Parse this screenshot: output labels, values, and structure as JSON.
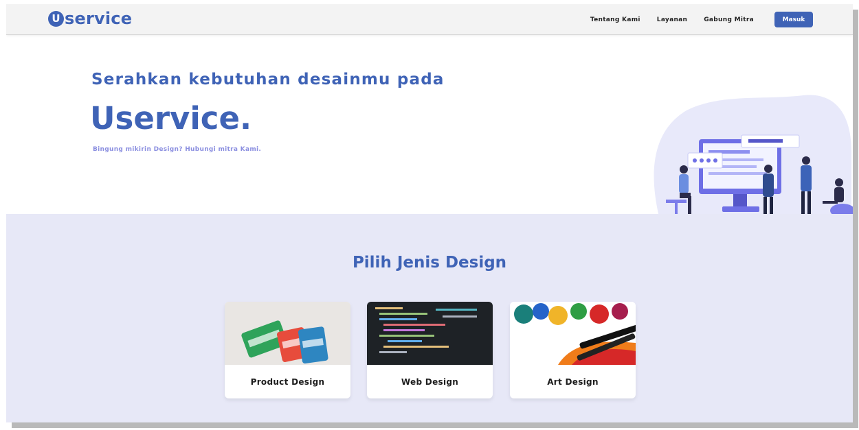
{
  "brand": {
    "logo_letter": "U",
    "logo_text": "service"
  },
  "nav": {
    "links": [
      "Tentang Kami",
      "Layanan",
      "Gabung Mitra"
    ],
    "login_label": "Masuk"
  },
  "hero": {
    "subtitle": "Serahkan kebutuhan desainmu pada",
    "title": "Uservice.",
    "tagline": "Bingung mikirin Design? Hubungi mitra Kami."
  },
  "categories": {
    "heading": "Pilih Jenis Design",
    "items": [
      {
        "label": "Product Design",
        "image": "product-packages-photo"
      },
      {
        "label": "Web Design",
        "image": "code-editor-photo"
      },
      {
        "label": "Art Design",
        "image": "paint-brush-photo"
      }
    ]
  },
  "colors": {
    "brand": "#3f63b6",
    "tagline": "#8b8fe0",
    "section_bg": "#e7e8f7",
    "navbar_bg": "#f3f3f3"
  }
}
